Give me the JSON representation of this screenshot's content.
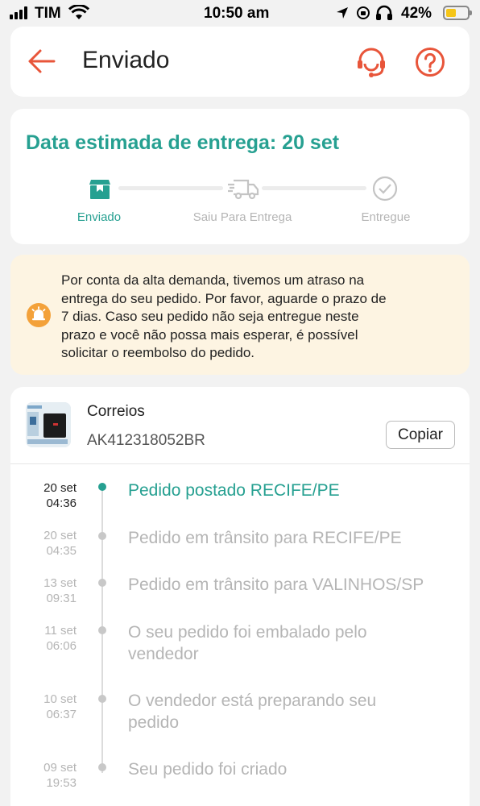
{
  "status_bar": {
    "carrier": "TIM",
    "time": "10:50 am",
    "battery": "42%"
  },
  "header": {
    "title": "Enviado"
  },
  "delivery": {
    "estimate": "Data estimada de entrega: 20 set",
    "steps": [
      {
        "label": "Enviado",
        "state": "active"
      },
      {
        "label": "Saiu Para Entrega",
        "state": "pending"
      },
      {
        "label": "Entregue",
        "state": "pending"
      }
    ]
  },
  "notice": {
    "lines": [
      "Por conta da alta demanda, tivemos um atraso na",
      "entrega do seu pedido. Por favor, aguarde o prazo de",
      "7 dias. Caso seu pedido não seja entregue neste",
      "prazo e você não possa mais esperar, é possível",
      "solicitar o reembolso do pedido."
    ]
  },
  "shipment": {
    "carrier": "Correios",
    "tracking_code": "AK412318052BR",
    "copy_label": "Copiar"
  },
  "timeline": [
    {
      "date": "20 set",
      "time": "04:36",
      "lines": [
        "Pedido postado RECIFE/PE"
      ],
      "active": true
    },
    {
      "date": "20 set",
      "time": "04:35",
      "lines": [
        "Pedido em trânsito para RECIFE/PE"
      ],
      "active": false
    },
    {
      "date": "13 set",
      "time": "09:31",
      "lines": [
        "Pedido em trânsito para VALINHOS/SP"
      ],
      "active": false
    },
    {
      "date": "11 set",
      "time": "06:06",
      "lines": [
        "O seu pedido foi embalado pelo",
        "vendedor"
      ],
      "active": false
    },
    {
      "date": "10 set",
      "time": "06:37",
      "lines": [
        "O vendedor está preparando seu",
        "pedido"
      ],
      "active": false
    },
    {
      "date": "09 set",
      "time": "19:53",
      "lines": [
        "Seu pedido foi criado"
      ],
      "active": false
    }
  ],
  "colors": {
    "accent": "#26a091",
    "brand_orange": "#e8553a",
    "notice_bg": "#fdf4e2",
    "notice_icon": "#f3a13a"
  }
}
